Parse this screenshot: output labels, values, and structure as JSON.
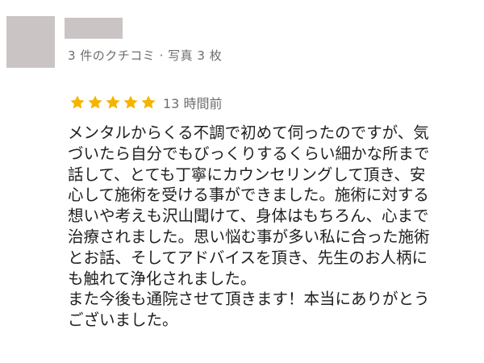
{
  "reviewer": {
    "meta": "3 件のクチコミ · 写真 3 枚"
  },
  "rating": {
    "stars": 5,
    "max_stars": 5,
    "star_color": "#f5b400",
    "time": "13 時間前"
  },
  "review": {
    "lines": [
      "メンタルからくる不調で初めて伺ったのですが、気",
      "づいたら自分でもびっくりするくらい細かな所まで",
      "話して、とても丁寧にカウンセリングして頂き、安",
      "心して施術を受ける事ができました。施術に対する",
      "想いや考えも沢山聞けて、身体はもちろん、心まで",
      "治療されました。思い悩む事が多い私に合った施術",
      "とお話、そしてアドバイスを頂き、先生のお人柄に",
      "も触れて浄化されました。",
      "また今後も通院させて頂きます！本当にありがとう",
      "ございました。"
    ]
  }
}
